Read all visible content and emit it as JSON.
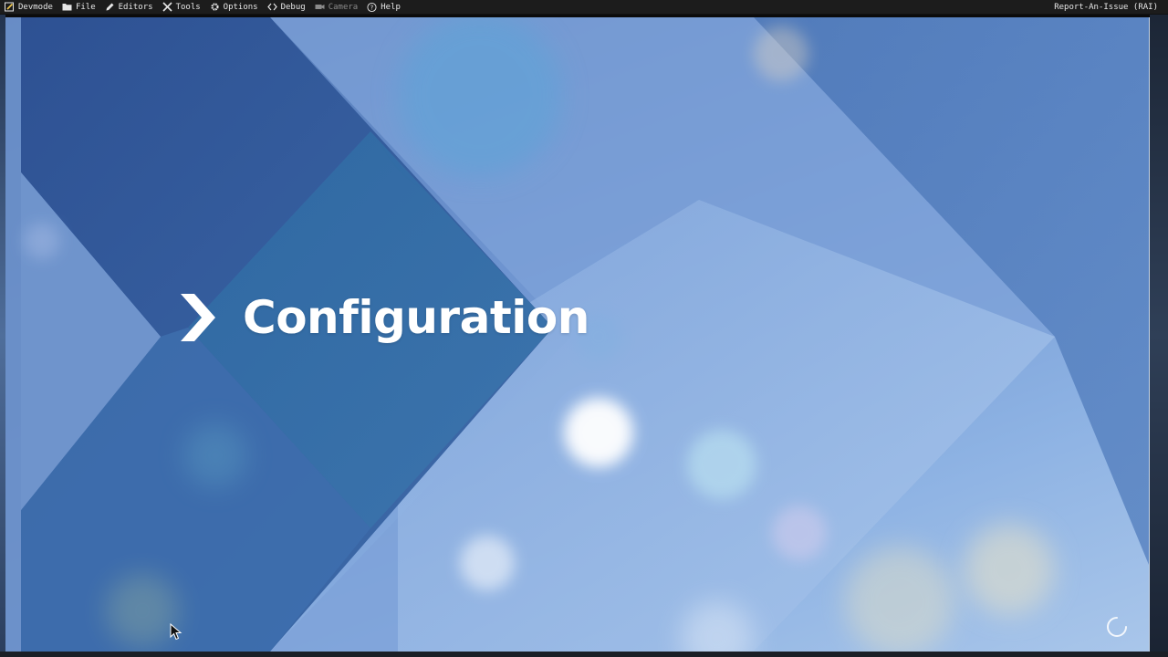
{
  "menubar": {
    "items": [
      {
        "label": "Devmode",
        "icon": "devmode-icon"
      },
      {
        "label": "File",
        "icon": "folder-icon"
      },
      {
        "label": "Editors",
        "icon": "pencil-icon"
      },
      {
        "label": "Tools",
        "icon": "tools-icon"
      },
      {
        "label": "Options",
        "icon": "gear-icon"
      },
      {
        "label": "Debug",
        "icon": "code-icon"
      },
      {
        "label": "Camera",
        "icon": "camera-icon",
        "disabled": true
      },
      {
        "label": "Help",
        "icon": "help-icon"
      }
    ],
    "right_label": "Report-An-Issue (RAI)"
  },
  "screen": {
    "title": "Configuration",
    "title_icon": "chevron-right-icon",
    "status_icon": "loading-spinner-icon"
  },
  "colors": {
    "menubar_bg": "#1c1c1c",
    "title_text": "#ffffff",
    "background_blue": "#6d93cf"
  }
}
